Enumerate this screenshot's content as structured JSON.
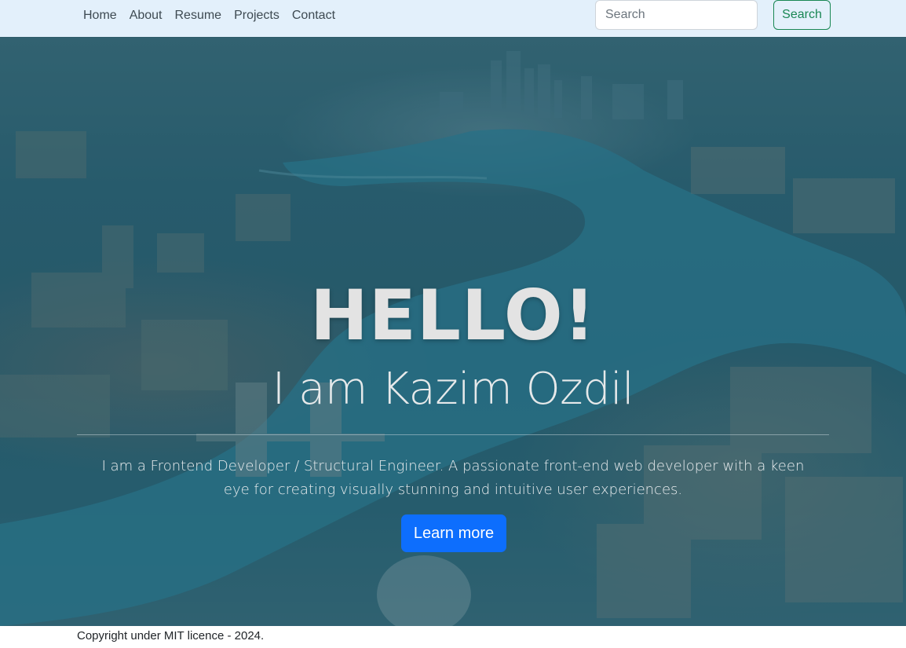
{
  "navbar": {
    "links": [
      {
        "label": "Home"
      },
      {
        "label": "About"
      },
      {
        "label": "Resume"
      },
      {
        "label": "Projects"
      },
      {
        "label": "Contact"
      }
    ],
    "search": {
      "placeholder": "Search",
      "button_label": "Search"
    }
  },
  "hero": {
    "title": "HELLO!",
    "subtitle": "I am Kazim Ozdil",
    "description": "I am a Frontend Developer / Structural Engineer. A passionate front-end web developer with a keen eye for creating visually stunning and intuitive user experiences.",
    "cta_label": "Learn more"
  },
  "footer": {
    "copyright": "Copyright under MIT licence - 2024."
  },
  "colors": {
    "navbar_bg": "#e3f0fb",
    "search_button": "#198754",
    "cta_button": "#0d6efd",
    "hero_overlay": "#2b5968"
  }
}
